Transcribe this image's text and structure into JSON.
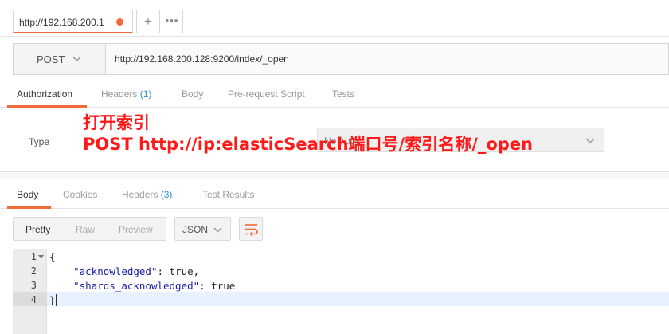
{
  "tabbar": {
    "active_tab_label": "http://192.168.200.1",
    "add_label": "+",
    "more_label": "•••"
  },
  "request": {
    "method": "POST",
    "url": "http://192.168.200.128:9200/index/_open"
  },
  "request_tabs": [
    {
      "label": "Authorization",
      "count": ""
    },
    {
      "label": "Headers",
      "count": "(1)"
    },
    {
      "label": "Body",
      "count": ""
    },
    {
      "label": "Pre-request Script",
      "count": ""
    },
    {
      "label": "Tests",
      "count": ""
    }
  ],
  "auth": {
    "type_label": "Type",
    "type_value": "No Auth"
  },
  "annotation": {
    "line1": "打开索引",
    "line2": "POST http://ip:elasticSearch端口号/索引名称/_open",
    "color": "#ff1a1a"
  },
  "response_tabs": [
    {
      "label": "Body",
      "count": ""
    },
    {
      "label": "Cookies",
      "count": ""
    },
    {
      "label": "Headers",
      "count": "(3)"
    },
    {
      "label": "Test Results",
      "count": ""
    }
  ],
  "view_modes": [
    "Pretty",
    "Raw",
    "Preview"
  ],
  "format": "JSON",
  "code": {
    "line_numbers": [
      "1",
      "2",
      "3",
      "4"
    ],
    "open_brace": "{",
    "key1": "\"acknowledged\"",
    "val1": "true,",
    "key2": "\"shards_acknowledged\"",
    "val2": "true",
    "close_brace": "}"
  },
  "colors": {
    "accent": "#f26b3a",
    "count": "#2a8ccf",
    "json_key": "#1a1aa6"
  }
}
